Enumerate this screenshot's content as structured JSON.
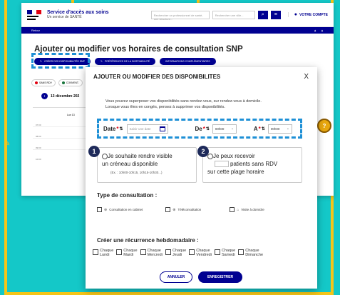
{
  "brand": {
    "title": "Service d'accès aux soins",
    "subtitle": "Un service de SANTÉ",
    "logo_text": "RÉPUBLIQUE FRANÇAISE"
  },
  "header": {
    "search_placeholder": "Rechercher un professionnel de santé, une structure...",
    "location_placeholder": "Rechercher une ville...",
    "account_label": "VOTRE COMPTE"
  },
  "nav": {
    "home": "Retour"
  },
  "page": {
    "title": "Ajouter ou modifier vos horaires de consultation SNP"
  },
  "actions": [
    {
      "label": "CRÉER DES DISPONIBILITÉS SNP"
    },
    {
      "label": "PRÉFÉRENCES DE LA DISPONIBILITÉ"
    },
    {
      "label": "INFORMATIONS COMPLÉMENTAIRES"
    }
  ],
  "filters": [
    {
      "label": "SANS RDV",
      "color": "#e1000f"
    },
    {
      "label": "CONVENT.",
      "color": "#18753c"
    }
  ],
  "calendar": {
    "date_label": "13 décembre 202",
    "day_label": "Lun 13",
    "hours": [
      "07:00",
      "08:00",
      "09:00",
      "10:00"
    ]
  },
  "help_badge": "?",
  "modal": {
    "title": "AJOUTER OU MODIFIER DES DISPONIBILITES",
    "close": "X",
    "description": "Vous pouvez superposer vos disponibilités sans rendez-vous, sur rendez-vous à domicile. Lorsque vous êtes en congés, pensez à supprimer vos disponibilités.",
    "date": {
      "label": "Date",
      "placeholder": "Saisir une date"
    },
    "from": {
      "label": "De",
      "value": "00h00"
    },
    "to": {
      "label": "A",
      "value": "00h00"
    },
    "option1": {
      "badge": "1",
      "line1": "Je souhaite rendre visible",
      "line2": "un créneau disponible",
      "example": "(Ex. : 10h00-10h15, 10h15-10h30...)"
    },
    "option2": {
      "badge": "2",
      "line1": "Je peux recevoir",
      "line2": "patients sans RDV",
      "line3": "sur cette plage horaire"
    },
    "consultation_title": "Type de consultation :",
    "consultation_types": [
      "Consultation en cabinet",
      "Téléconsultation",
      "Visite à domicile"
    ],
    "recurrence_title": "Créer une récurrence hebdomadaire :",
    "days": [
      {
        "l1": "Chaque",
        "l2": "Lundi"
      },
      {
        "l1": "Chaque",
        "l2": "Mardi"
      },
      {
        "l1": "Chaque",
        "l2": "Mercredi"
      },
      {
        "l1": "Chaque",
        "l2": "Jeudi"
      },
      {
        "l1": "Chaque",
        "l2": "Vendredi"
      },
      {
        "l1": "Chaque",
        "l2": "Samedi"
      },
      {
        "l1": "Chaque",
        "l2": "Dimanche"
      }
    ],
    "cancel": "ANNULER",
    "save": "ENREGISTRER"
  },
  "colors": {
    "accent": "#000091",
    "background": "#14c8c8",
    "frame": "#f5c518",
    "highlight": "#1e90d6"
  }
}
